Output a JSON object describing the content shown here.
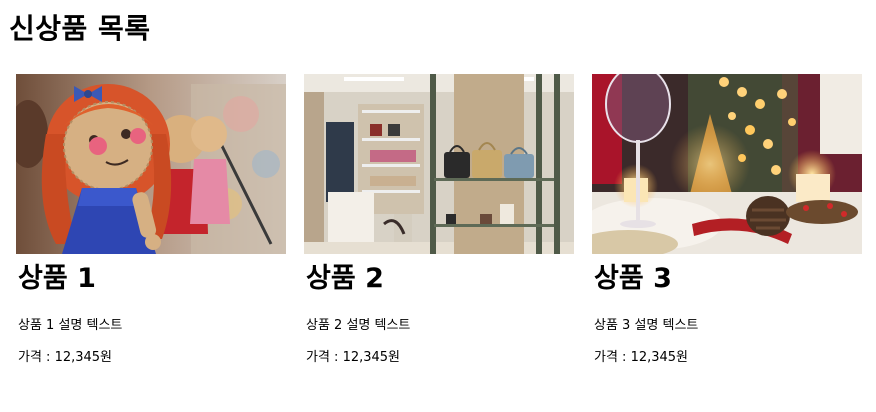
{
  "page": {
    "title": "신상품 목록"
  },
  "products": [
    {
      "name": "상품 1",
      "description": "상품 1 설명 텍스트",
      "price": "가격 : 12,345원",
      "image": "knitted-dolls-photo"
    },
    {
      "name": "상품 2",
      "description": "상품 2 설명 텍스트",
      "price": "가격 : 12,345원",
      "image": "handbag-store-photo"
    },
    {
      "name": "상품 3",
      "description": "상품 3 설명 텍스트",
      "price": "가격 : 12,345원",
      "image": "christmas-table-photo"
    }
  ]
}
